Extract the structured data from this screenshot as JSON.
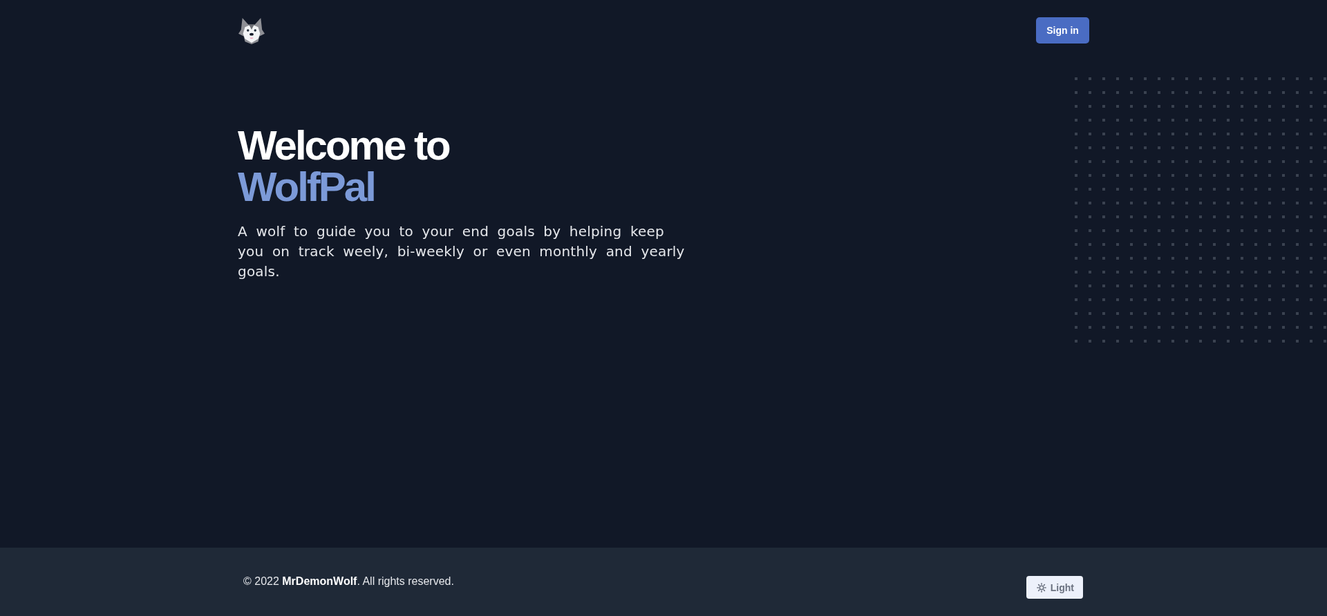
{
  "header": {
    "sign_in_button": {
      "label": "Sign in"
    }
  },
  "hero": {
    "title_parts": [
      {
        "text": "Welcome to",
        "kind": "plain"
      },
      {
        "text": "WolfPal",
        "kind": "accent"
      }
    ],
    "description": "A wolf to guide you to your end goals by helping keep you on track weely, bi-weekly or even monthly and yearly goals."
  },
  "footer": {
    "copyright": "© 2022 **MrDemonWolf**. All rights reserved.",
    "theme_toggle": {
      "label": "Light"
    }
  }
}
